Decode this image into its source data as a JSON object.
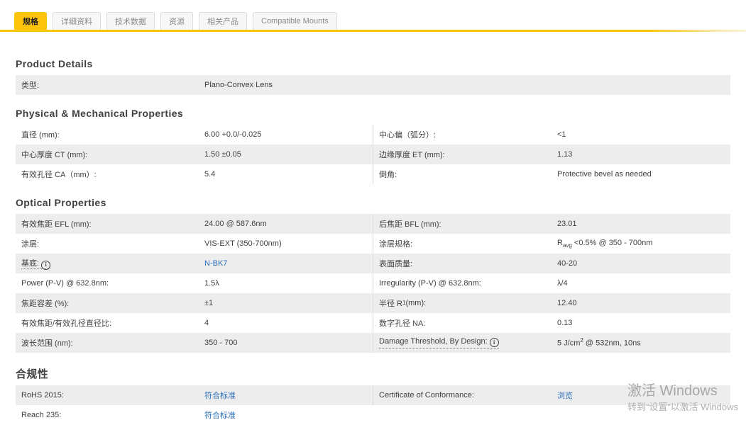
{
  "colors": {
    "accent_yellow": "#fdc40e",
    "link_blue": "#2a6ebb",
    "row_gray": "#ededed",
    "heading_text": "#414042"
  },
  "tabs": {
    "items": [
      {
        "label": "规格",
        "active": true
      },
      {
        "label": "详细资料",
        "active": false
      },
      {
        "label": "技术数据",
        "active": false
      },
      {
        "label": "资源",
        "active": false
      },
      {
        "label": "相关产品",
        "active": false
      },
      {
        "label": "Compatible Mounts",
        "active": false
      }
    ]
  },
  "sections": {
    "product": {
      "heading": "Product Details",
      "row1": {
        "l": "类型:",
        "lv": "Plano-Convex Lens"
      }
    },
    "physical": {
      "heading": "Physical & Mechanical Properties",
      "row1": {
        "l": "直径 (mm):",
        "lv": "6.00 +0.0/-0.025",
        "r": "中心偏（弧分）:",
        "rv": "<1"
      },
      "row2": {
        "l": "中心厚度 CT (mm):",
        "lv": "1.50 ±0.05",
        "r": "边缘厚度 ET (mm):",
        "rv": "1.13"
      },
      "row3": {
        "l": "有效孔径 CA（mm）:",
        "lv": "5.4",
        "r": "倒角:",
        "rv": "Protective bevel as needed"
      }
    },
    "optical": {
      "heading": "Optical Properties",
      "row1": {
        "l": "有效焦距 EFL (mm):",
        "lv": "24.00 @ 587.6nm",
        "r": "后焦距 BFL (mm):",
        "rv": "23.01"
      },
      "row2": {
        "l": "涂层:",
        "lv": "VIS-EXT (350-700nm)",
        "r": "涂层规格:",
        "rv_p1": "R",
        "rv_sub": "avg",
        "rv_p2": " <0.5% @ 350 - 700nm"
      },
      "row3": {
        "l": "基底:",
        "lv_link": "N-BK7",
        "r": "表面质量:",
        "rv": "40-20"
      },
      "row4": {
        "l": "Power (P-V) @ 632.8nm:",
        "lv": "1.5λ",
        "r": "Irregularity (P-V) @ 632.8nm:",
        "rv": "λ/4"
      },
      "row5": {
        "l": "焦距容差 (%):",
        "lv": "±1",
        "r_p1": "半径 R",
        "r_sub": "1",
        "r_p2": " (mm):",
        "rv": "12.40"
      },
      "row6": {
        "l": "有效焦距/有效孔径直径比:",
        "lv": "4",
        "r": "数字孔径 NA:",
        "rv": "0.13"
      },
      "row7": {
        "l": "波长范围 (nm):",
        "lv": "350 - 700",
        "r": "Damage Threshold, By Design:",
        "rv_p1": "5 J/cm",
        "rv_sup": "2",
        "rv_p2": " @ 532nm, 10ns"
      }
    },
    "compliance": {
      "heading": "合规性",
      "row1": {
        "l": "RoHS 2015:",
        "lv_link": "符合标准",
        "r": "Certificate of Conformance:",
        "rv_link": "浏览"
      },
      "row2": {
        "l": "Reach 235:",
        "lv_link": "符合标准"
      }
    }
  },
  "watermark": {
    "line1": "激活 Windows",
    "line2": "转到“设置”以激活 Windows"
  }
}
